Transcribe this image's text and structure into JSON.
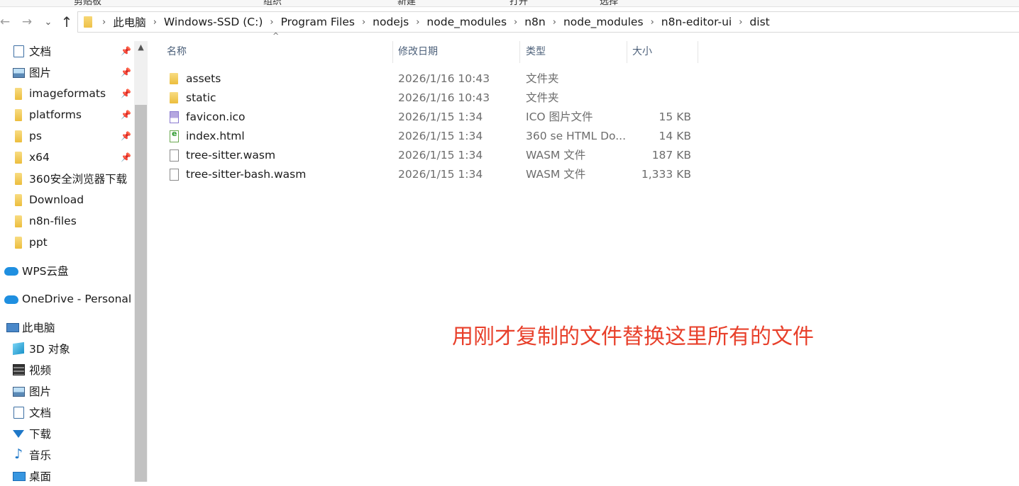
{
  "window": {
    "ribbon_tabs": [
      "剪贴板",
      "组织",
      "新建",
      "打开",
      "选择"
    ]
  },
  "nav": {
    "back_icon": "arrow-left-icon",
    "forward_icon": "arrow-right-icon",
    "history_icon": "chevron-down-icon",
    "up_icon": "arrow-up-icon"
  },
  "address": {
    "crumbs": [
      "此电脑",
      "Windows-SSD (C:)",
      "Program Files",
      "nodejs",
      "node_modules",
      "n8n",
      "node_modules",
      "n8n-editor-ui",
      "dist"
    ]
  },
  "sidebar": {
    "items": [
      {
        "label": "文档",
        "icon": "document-icon",
        "pinned": true
      },
      {
        "label": "图片",
        "icon": "picture-icon",
        "pinned": true
      },
      {
        "label": "imageformats",
        "icon": "folder-icon",
        "pinned": true
      },
      {
        "label": "platforms",
        "icon": "folder-icon",
        "pinned": true
      },
      {
        "label": "ps",
        "icon": "folder-icon",
        "pinned": true
      },
      {
        "label": "x64",
        "icon": "folder-icon",
        "pinned": true
      },
      {
        "label": "360安全浏览器下载",
        "icon": "folder-icon",
        "pinned": false
      },
      {
        "label": "Download",
        "icon": "folder-icon",
        "pinned": false
      },
      {
        "label": "n8n-files",
        "icon": "folder-icon",
        "pinned": false
      },
      {
        "label": "ppt",
        "icon": "folder-icon",
        "pinned": false
      },
      {
        "label": "WPS云盘",
        "icon": "cloud-icon",
        "pinned": false
      },
      {
        "label": "OneDrive - Personal",
        "icon": "cloud-icon",
        "pinned": false
      },
      {
        "label": "此电脑",
        "icon": "computer-icon",
        "pinned": false
      },
      {
        "label": "3D 对象",
        "icon": "cube-icon",
        "pinned": false
      },
      {
        "label": "视频",
        "icon": "video-icon",
        "pinned": false
      },
      {
        "label": "图片",
        "icon": "picture-icon",
        "pinned": false
      },
      {
        "label": "文档",
        "icon": "document-icon",
        "pinned": false
      },
      {
        "label": "下载",
        "icon": "download-icon",
        "pinned": false
      },
      {
        "label": "音乐",
        "icon": "music-icon",
        "pinned": false
      },
      {
        "label": "桌面",
        "icon": "desktop-icon",
        "pinned": false
      }
    ]
  },
  "columns": {
    "name": "名称",
    "modified": "修改日期",
    "type": "类型",
    "size": "大小"
  },
  "files": [
    {
      "name": "assets",
      "modified": "2026/1/16 10:43",
      "type": "文件夹",
      "size": "",
      "icon": "folder-icon"
    },
    {
      "name": "static",
      "modified": "2026/1/16 10:43",
      "type": "文件夹",
      "size": "",
      "icon": "folder-icon"
    },
    {
      "name": "favicon.ico",
      "modified": "2026/1/15 1:34",
      "type": "ICO 图片文件",
      "size": "15 KB",
      "icon": "image-file-icon"
    },
    {
      "name": "index.html",
      "modified": "2026/1/15 1:34",
      "type": "360 se HTML Do...",
      "size": "14 KB",
      "icon": "html-file-icon"
    },
    {
      "name": "tree-sitter.wasm",
      "modified": "2026/1/15 1:34",
      "type": "WASM 文件",
      "size": "187 KB",
      "icon": "file-icon"
    },
    {
      "name": "tree-sitter-bash.wasm",
      "modified": "2026/1/15 1:34",
      "type": "WASM 文件",
      "size": "1,333 KB",
      "icon": "file-icon"
    }
  ],
  "annotation": {
    "text": "用刚才复制的文件替换这里所有的文件",
    "color": "#e8402b"
  }
}
